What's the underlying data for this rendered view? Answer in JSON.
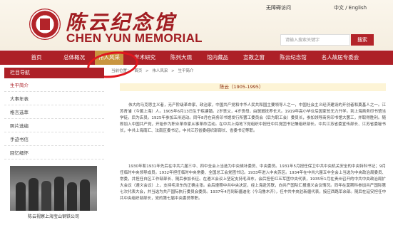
{
  "header": {
    "title_cn": "陈云纪念馆",
    "title_en": "CHEN YUN MEMORIAL",
    "link_wuzhang": "无障碍访问",
    "link_lang": "中文 / English",
    "search_placeholder": "请输入搜索关键字",
    "search_button": "搜索"
  },
  "nav": [
    "首页",
    "总体概况",
    "伟人风采",
    "学术研究",
    "陈列大观",
    "馆内藏品",
    "宣教之窗",
    "陈云纪念馆",
    "名人故居专委会"
  ],
  "breadcrumb": [
    "当前位置：",
    "首页",
    ">",
    "伟人风采",
    ">",
    "生平简介"
  ],
  "sidebar": {
    "heading": "栏目导航",
    "items": [
      "生平简介",
      "大事年表",
      "格言选萃",
      "照片选编",
      "手迹书信",
      "回忆缅怀"
    ],
    "caption": "陈云视察上海宝山钢铁公司"
  },
  "content": {
    "title": "陈云（1905-1995）",
    "para1": "伟大的马克思主义者，无产阶级革命家、政治家，中国共产党和中华人民共和国主要领导人之一，中国社会主义经济建设的开创者和奠基人之一。江苏青浦（今属上海）人。1905年6月13日生于练塘镇。2岁丧父，4岁丧母，由舅舅抚养长大。1919年高小毕业后因家贫无力升学。到上海商务印书馆当学徒。后为店员。1925年参加五卅运动。同年8月在商务印书馆发行所罢工委员会（后为职工会）委员长，参加领导商务印书馆大罢工，并取得胜利。随即加入中国共产党，开始作为职业革命家从事革命活动。在中共上海地下党组织中担任中共党团书记兼组织部长。中共江苏省委宣传部长、江苏省委秘书长，中共上海南汇、法南区委书记，中共江苏省委组织部部长、省委书记等职。",
    "para2": "1930年和1931年先后在中共六届三中、四中全会上当选为中央候补委员、中央委员。1931年5月担任保卫中共中央机关安全的中央特科书记；9月任临时中央领导成员。1932年担任临时中央常委、全国总工会党团书记。1933年进入中央苏区。1934年在中共六届五中全会上当选为中央政治局委员、常委，并担任白区工作部部长、随后参加长征。在遵义会议上坚定支持毛泽东，会后担任红五军团中央代表，1935年1月在贵州召开的中共中央政治局扩大会议（遵义会议）上，支持毛泽东的正确主张。会后遵照中共中央决定，经上海赴苏联，向共产国际汇报遵义会议情况。同年在莫斯科参加共产国际第七次代表大会，并当选为共产国际执行委员会委员。1937年4月到新疆迪化（今乌鲁木齐），任中共中央驻新疆代表，接应西路军余部。随后在延安担任中共中央组织部部长，党的第七届中央委员等职。"
  }
}
